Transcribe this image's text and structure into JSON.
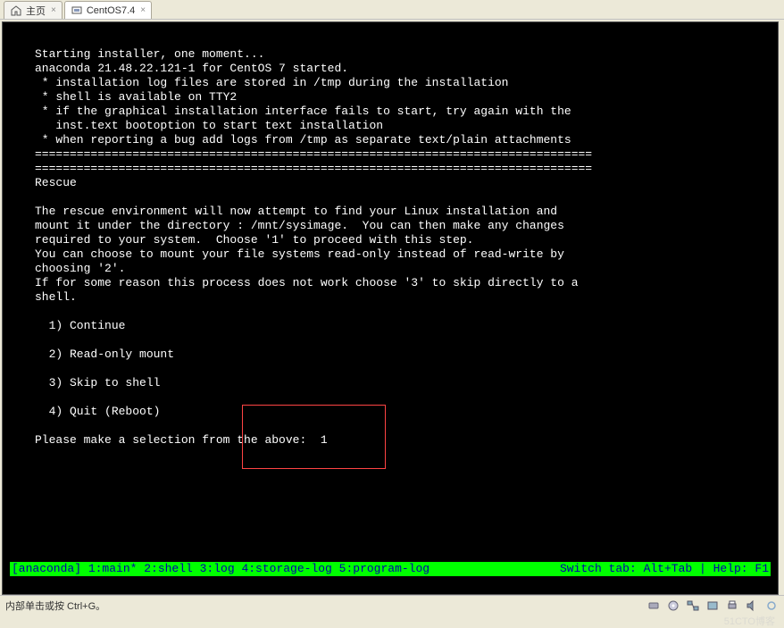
{
  "tabs": [
    {
      "label": "主页",
      "active": false
    },
    {
      "label": "CentOS7.4",
      "active": true
    }
  ],
  "terminal_lines": [
    "Starting installer, one moment...",
    "anaconda 21.48.22.121-1 for CentOS 7 started.",
    " * installation log files are stored in /tmp during the installation",
    " * shell is available on TTY2",
    " * if the graphical installation interface fails to start, try again with the",
    "   inst.text bootoption to start text installation",
    " * when reporting a bug add logs from /tmp as separate text/plain attachments",
    "================================================================================",
    "================================================================================",
    "Rescue",
    "",
    "The rescue environment will now attempt to find your Linux installation and",
    "mount it under the directory : /mnt/sysimage.  You can then make any changes",
    "required to your system.  Choose '1' to proceed with this step.",
    "You can choose to mount your file systems read-only instead of read-write by",
    "choosing '2'.",
    "If for some reason this process does not work choose '3' to skip directly to a",
    "shell.",
    "",
    "  1) Continue",
    "",
    "  2) Read-only mount",
    "",
    "  3) Skip to shell",
    "",
    "  4) Quit (Reboot)",
    "",
    "Please make a selection from the above:  1"
  ],
  "status_left": "[anaconda] 1:main* 2:shell  3:log  4:storage-log  5:program-log",
  "status_right": "Switch tab: Alt+Tab | Help: F1",
  "footer_text": "内部单击或按 Ctrl+G。"
}
